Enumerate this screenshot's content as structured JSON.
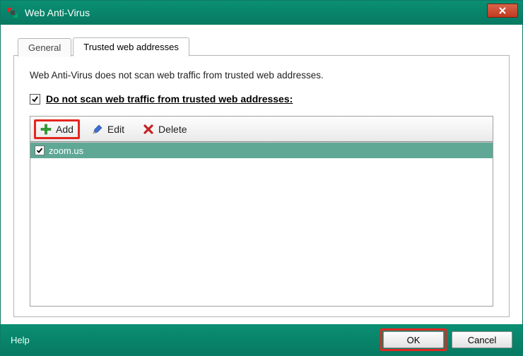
{
  "title": "Web Anti-Virus",
  "tabs": {
    "general": "General",
    "trusted": "Trusted web addresses"
  },
  "panel": {
    "description": "Web Anti-Virus does not scan web traffic from trusted web addresses.",
    "checkbox_label": "Do not scan web traffic from trusted web addresses:"
  },
  "toolbar": {
    "add": "Add",
    "edit": "Edit",
    "delete": "Delete"
  },
  "list": {
    "items": [
      {
        "label": "zoom.us",
        "checked": true,
        "selected": true
      }
    ]
  },
  "footer": {
    "help": "Help",
    "ok": "OK",
    "cancel": "Cancel"
  }
}
